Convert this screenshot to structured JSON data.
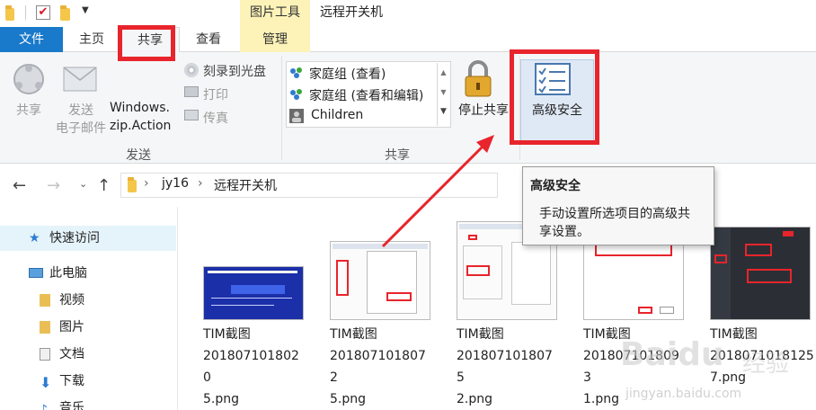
{
  "quick_access": {
    "icons": [
      "folder-icon",
      "properties-check-icon",
      "folder-icon",
      "dropdown-icon"
    ]
  },
  "context_tab_header": "图片工具",
  "window_title": "远程开关机",
  "tabs": [
    {
      "label": "文件"
    },
    {
      "label": "主页"
    },
    {
      "label": "共享"
    },
    {
      "label": "查看"
    },
    {
      "label": "管理"
    }
  ],
  "ribbon": {
    "send_group": {
      "label": "发送",
      "share_label": "共享",
      "email_label_1": "发送",
      "email_label_2": "电子邮件",
      "zip_label_1": "Windows.",
      "zip_label_2": "zip.Action",
      "burn_label": "刻录到光盘",
      "print_label": "打印",
      "fax_label": "传真"
    },
    "share_group": {
      "label": "共享",
      "items": [
        {
          "label": "家庭组 (查看)"
        },
        {
          "label": "家庭组 (查看和编辑)"
        },
        {
          "label": "Children"
        }
      ],
      "stop_share_label": "停止共享"
    },
    "advanced_security_label": "高级安全"
  },
  "navbar": {
    "path": [
      "jy16",
      "远程开关机"
    ],
    "separator": "›"
  },
  "sidebar": {
    "items": [
      {
        "label": "快速访问"
      },
      {
        "label": "此电脑"
      },
      {
        "label": "视频"
      },
      {
        "label": "图片"
      },
      {
        "label": "文档"
      },
      {
        "label": "下载"
      },
      {
        "label": "音乐"
      }
    ]
  },
  "files": [
    {
      "name_1": "TIM截图",
      "name_2": "2018071018020",
      "name_3": "5.png"
    },
    {
      "name_1": "TIM截图",
      "name_2": "2018071018072",
      "name_3": "5.png"
    },
    {
      "name_1": "TIM截图",
      "name_2": "2018071018075",
      "name_3": "2.png"
    },
    {
      "name_1": "TIM截图",
      "name_2": "2018071018093",
      "name_3": "1.png"
    },
    {
      "name_1": "TIM截图",
      "name_2": "2018071018125",
      "name_3": "7.png"
    }
  ],
  "tooltip": {
    "title": "高级安全",
    "body_1": "手动设置所选项目的高级共",
    "body_2": "享设置。"
  },
  "watermark": {
    "brand": "Baidu",
    "sub": "经验",
    "url": "jingyan.baidu.com"
  },
  "colors": {
    "file_tab": "#1979ca",
    "context_tab": "#fdf3b8",
    "annotation_red": "#e8242c",
    "ribbon_bg": "#f5f6f7"
  }
}
